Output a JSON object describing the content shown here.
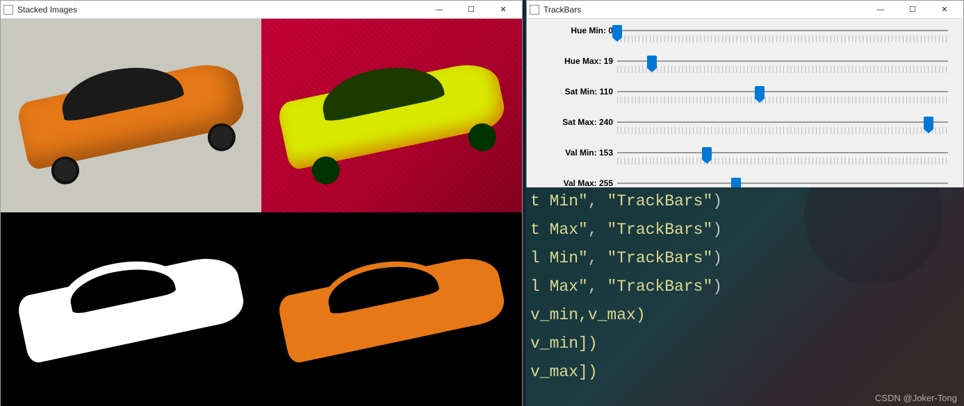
{
  "windows": {
    "stacked": {
      "title": "Stacked Images"
    },
    "trackbars": {
      "title": "TrackBars"
    }
  },
  "winControls": {
    "min": "—",
    "max": "☐",
    "close": "✕"
  },
  "trackbars": [
    {
      "label": "Hue Min:",
      "value": 0,
      "max": 179,
      "pos_pct": 0.0
    },
    {
      "label": "Hue Max:",
      "value": 19,
      "max": 179,
      "pos_pct": 10.6
    },
    {
      "label": "Sat Min:",
      "value": 110,
      "max": 255,
      "pos_pct": 43.1
    },
    {
      "label": "Sat Max:",
      "value": 240,
      "max": 255,
      "pos_pct": 94.1
    },
    {
      "label": "Val Min:",
      "value": 153,
      "max": 255,
      "pos_pct": 27.0
    },
    {
      "label": "Val Max:",
      "value": 255,
      "max": 255,
      "pos_pct": 36.0
    }
  ],
  "code": {
    "lines": [
      {
        "pre": "t Min\"",
        "mid": ", ",
        "str": "\"TrackBars\"",
        "end": ")"
      },
      {
        "pre": "t Max\"",
        "mid": ", ",
        "str": "\"TrackBars\"",
        "end": ")"
      },
      {
        "pre": "l Min\"",
        "mid": ", ",
        "str": "\"TrackBars\"",
        "end": ")"
      },
      {
        "pre": "l Max\"",
        "mid": ", ",
        "str": "\"TrackBars\"",
        "end": ")"
      },
      {
        "pre": "v_min,v_max)",
        "mid": "",
        "str": "",
        "end": ""
      },
      {
        "pre": "v_min])",
        "mid": "",
        "str": "",
        "end": ""
      },
      {
        "pre": "v_max])",
        "mid": "",
        "str": "",
        "end": ""
      }
    ]
  },
  "watermark": "CSDN @Joker-Tong"
}
